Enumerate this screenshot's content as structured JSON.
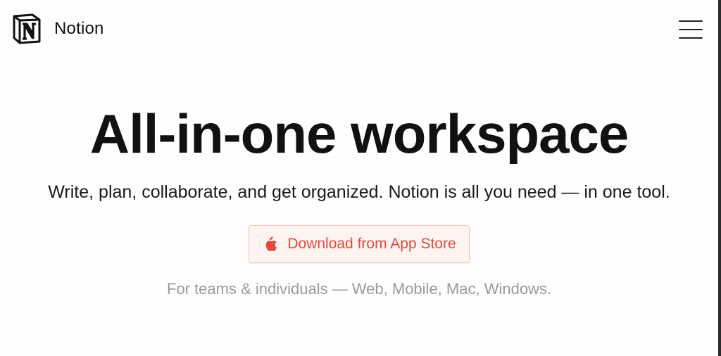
{
  "header": {
    "brand_name": "Notion",
    "logo_icon": "notion-logo-icon",
    "menu_icon": "hamburger-menu-icon"
  },
  "hero": {
    "title": "All-in-one workspace",
    "subtitle": "Write, plan, collaborate, and get organized. Notion is all you need — in one tool.",
    "cta": {
      "label": "Download from App Store",
      "icon": "apple-icon",
      "text_color": "#e04b3e",
      "background": "#fdf4f2",
      "border": "#f2c3bd"
    },
    "platforms_note": "For teams & individuals — Web, Mobile, Mac, Windows."
  },
  "colors": {
    "background": "#fffefc",
    "text": "#111111",
    "muted_text": "#9a9a9a",
    "accent": "#e04b3e"
  }
}
